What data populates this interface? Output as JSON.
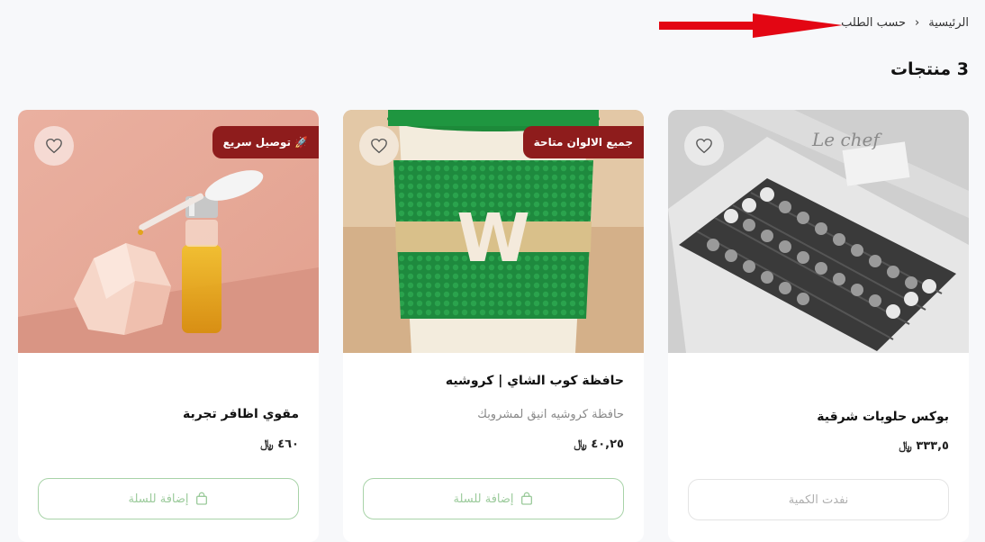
{
  "breadcrumb": {
    "home": "الرئيسية",
    "separator": "›",
    "current": "حسب الطلب"
  },
  "products_count": "3 منتجات",
  "colors": {
    "badge": "#8e1c1c",
    "add_button_border": "#a8d3a8",
    "add_button_text": "#9ccb9c",
    "annotation_arrow": "#e30613"
  },
  "products": [
    {
      "title": "مقوي اظافر تجربة",
      "description": "",
      "price": "٤٦٠",
      "currency": "﷼",
      "badge": "توصيل سريع",
      "badge_icon": "rocket-icon",
      "button_label": "إضافة للسلة",
      "button_icon": "shopping-bag-icon",
      "favorite_icon": "heart-icon"
    },
    {
      "title": "حافظة كوب الشاي | كروشيه",
      "description": "حافظة كروشيه انيق لمشروبك",
      "price": "٤٠,٢٥",
      "currency": "﷼",
      "badge": "جميع الالوان متاحة",
      "button_label": "إضافة للسلة",
      "button_icon": "shopping-bag-icon",
      "favorite_icon": "heart-icon",
      "cup_letter": "W"
    },
    {
      "title": "بوكس حلويات شرقية",
      "description": "",
      "price": "٣٣٣,٥",
      "currency": "﷼",
      "button_label": "نفدت الكمية",
      "favorite_icon": "heart-icon"
    }
  ]
}
